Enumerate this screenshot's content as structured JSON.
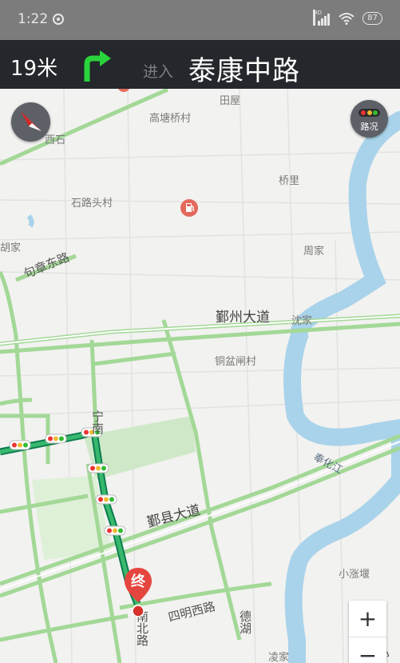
{
  "status_bar": {
    "time": "1:22",
    "network": "HD",
    "battery": "87"
  },
  "nav": {
    "distance": "19米",
    "enter": "进入",
    "road": "泰康中路"
  },
  "map": {
    "labels": {
      "tianwu": "田屋",
      "gaotangqiao": "高塘桥村",
      "xishi": "西石",
      "qiaoli": "桥里",
      "shilutou": "石路头村",
      "hujia": "胡家",
      "zhoujia": "周家",
      "juzhang_road": "句章东路",
      "yinzhou_avenue": "鄞州大道",
      "shenjia": "沈家",
      "tongpenzha": "铜盆闸村",
      "ning_nan": "宁南",
      "fenghua_river": "奉化江",
      "yinxian_avenue": "鄞县大道",
      "xiaozhangyan": "小涨堰",
      "siming_west": "四明西路",
      "nanbei": "南北路",
      "dehu": "德湖",
      "lingjia": "凌家",
      "gao_partial": "高"
    },
    "traffic_button_label": "路况",
    "zoom_in": "+",
    "zoom_out": "−",
    "destination_label": "终"
  }
}
